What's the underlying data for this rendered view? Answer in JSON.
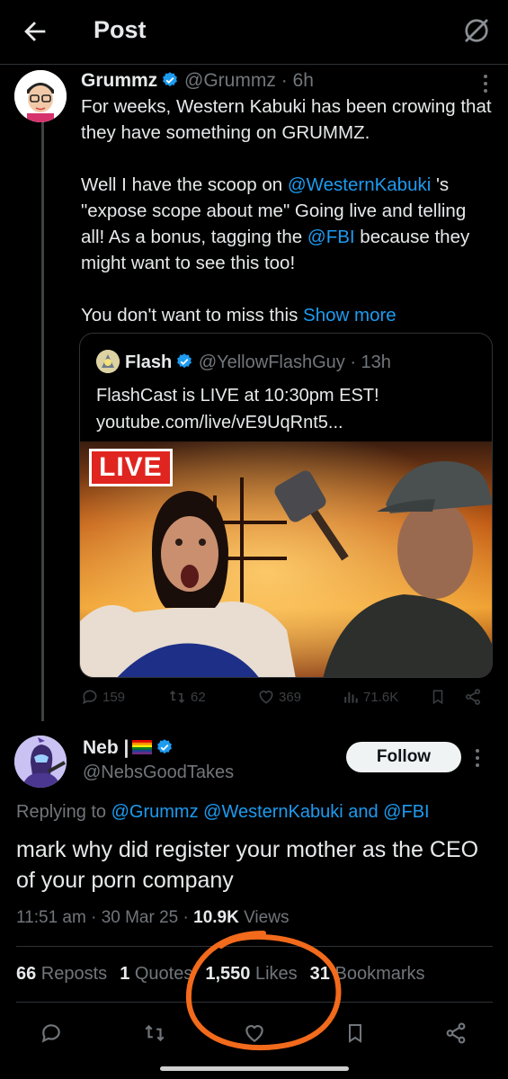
{
  "header": {
    "title": "Post"
  },
  "post": {
    "author_name": "Grummz",
    "author_handle": "@Grummz",
    "time": "· 6h",
    "paragraphs": [
      "For weeks, Western Kabuki has been crowing that they have something on GRUMMZ.",
      "Well I have the scoop on",
      "You don't want to miss this"
    ],
    "p2_link1": "@WesternKabuki",
    "p2_mid": " 's \"expose scope about me\" Going live and telling all! As a bonus, tagging the ",
    "p2_link2": "@FBI",
    "p2_end": " because they might want to see this too!",
    "show_more": "Show more"
  },
  "quote": {
    "author_name": "Flash",
    "author_handle": "@YellowFlashGuy",
    "time": "· 13h",
    "line1": "FlashCast is LIVE at 10:30pm EST!",
    "line2": "youtube.com/live/vE9UqRnt5...",
    "live_badge": "LIVE"
  },
  "actions": {
    "replies": "159",
    "reposts": "62",
    "likes": "369",
    "views": "71.6K"
  },
  "reply": {
    "author_name": "Neb |",
    "author_handle": "@NebsGoodTakes",
    "follow_label": "Follow",
    "replying_prefix": "Replying to ",
    "replying_to": "@Grummz @WesternKabuki and @FBI",
    "text": "mark why did register your mother as the CEO of your porn company",
    "timestamp": "11:51 am · 30 Mar 25 · ",
    "views_count": "10.9K",
    "views_label": " Views",
    "stats": {
      "reposts_count": "66",
      "reposts_label": " Reposts",
      "quotes_count": "1",
      "quotes_label": " Quotes",
      "likes_count": "1,550",
      "likes_label": " Likes",
      "bookmarks_count": "31",
      "bookmarks_label": " Bookmarks"
    }
  },
  "colors": {
    "accent": "#1d9bf0",
    "background": "#000000",
    "annotation": "#f26a1b"
  }
}
